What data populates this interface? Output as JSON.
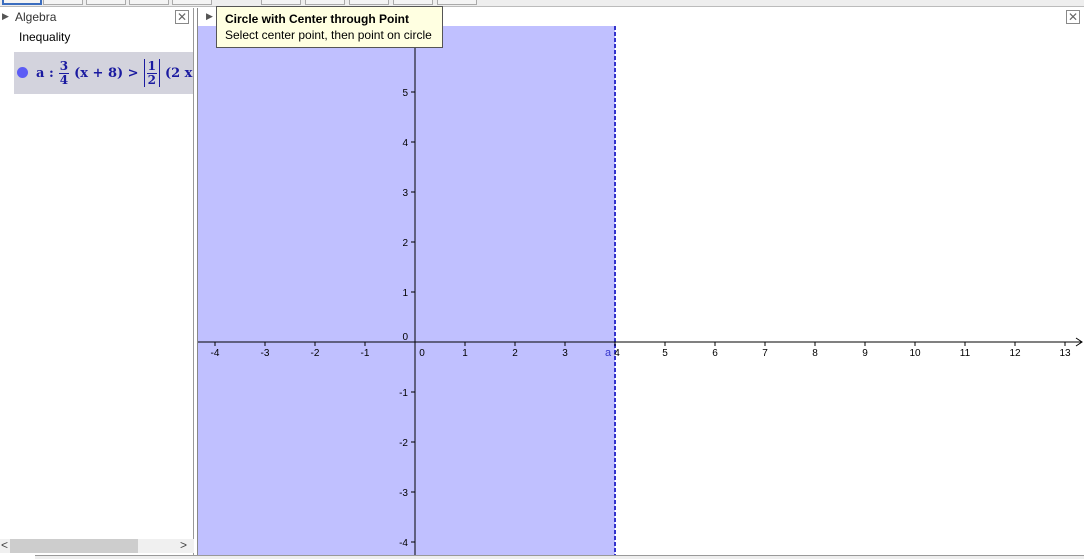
{
  "algebra": {
    "title": "Algebra",
    "category": "Inequality",
    "object": {
      "name": "a :",
      "frac1": {
        "num": "3",
        "den": "4"
      },
      "part1": "(x + 8) >",
      "frac2": {
        "num": "1",
        "den": "2"
      },
      "part2": "(2 x"
    }
  },
  "tooltip": {
    "title": "Circle with Center through Point",
    "text": "Select center point, then point on circle"
  },
  "graphics": {
    "x_ticks": [
      -4,
      -3,
      -2,
      -1,
      0,
      1,
      2,
      3,
      4,
      5,
      6,
      7,
      8,
      9,
      10,
      11,
      12,
      13
    ],
    "y_ticks": [
      -4,
      -3,
      -2,
      -1,
      0,
      1,
      2,
      3,
      4,
      5
    ],
    "boundary_x": 4,
    "boundary_label": "a",
    "region": "x < 4",
    "fill_color": "#c0c0ff",
    "line_color": "#3333cc"
  },
  "scroll": {
    "left": "<",
    "right": ">"
  }
}
